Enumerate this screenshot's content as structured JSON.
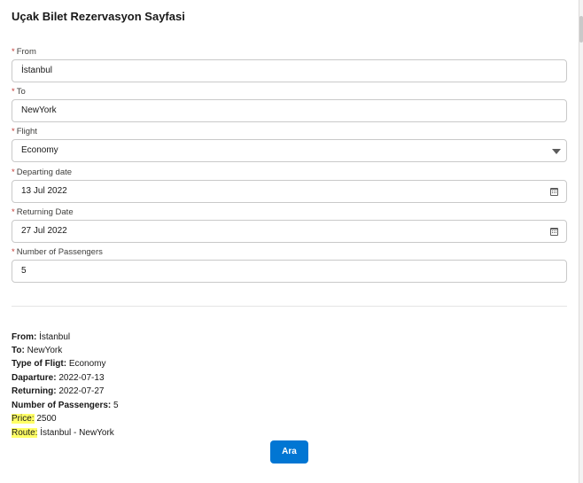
{
  "page": {
    "title": "Uçak Bilet Rezervasyon Sayfasi"
  },
  "form": {
    "required_mark": "*",
    "from": {
      "label": "From",
      "value": "İstanbul"
    },
    "to": {
      "label": "To",
      "value": "NewYork"
    },
    "flight": {
      "label": "Flight",
      "value": "Economy"
    },
    "departing": {
      "label": "Departing date",
      "value": "13 Jul 2022"
    },
    "returning": {
      "label": "Returning Date",
      "value": "27 Jul 2022"
    },
    "passengers": {
      "label": "Number of Passengers",
      "value": "5"
    }
  },
  "summary": {
    "from": {
      "label": "From:",
      "value": "İstanbul"
    },
    "to": {
      "label": "To:",
      "value": "NewYork"
    },
    "type": {
      "label": "Type of Fligt:",
      "value": "Economy"
    },
    "departure": {
      "label": "Daparture:",
      "value": "2022-07-13"
    },
    "returning": {
      "label": "Returning:",
      "value": "2022-07-27"
    },
    "passengers": {
      "label": "Number of Passengers:",
      "value": "5"
    },
    "price": {
      "label": "Price:",
      "value": "2500"
    },
    "route": {
      "label": "Route:",
      "value": "İstanbul - NewYork"
    }
  },
  "actions": {
    "search_label": "Ara"
  },
  "colors": {
    "accent": "#0176d3",
    "required": "#c23934",
    "highlight": "#ffff66"
  },
  "icons": {
    "dropdown": "chevron-down-icon",
    "date": "calendar-icon"
  }
}
